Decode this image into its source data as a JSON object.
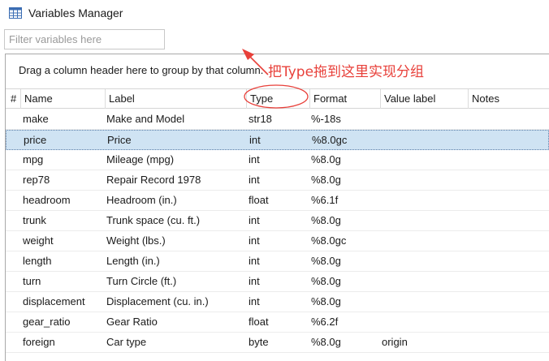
{
  "window": {
    "title": "Variables Manager",
    "icon": "grid-table-icon"
  },
  "filter": {
    "placeholder": "Filter variables here",
    "value": ""
  },
  "group_panel": {
    "hint": "Drag a column header here to group by that column."
  },
  "annotation": {
    "text": "把Type拖到这里实现分组",
    "color": "#e8403a"
  },
  "columns": [
    "#",
    "Name",
    "Label",
    "Type",
    "Format",
    "Value label",
    "Notes"
  ],
  "rows": [
    {
      "name": "make",
      "label": "Make and Model",
      "type": "str18",
      "format": "%-18s",
      "value_label": "",
      "notes": ""
    },
    {
      "name": "price",
      "label": "Price",
      "type": "int",
      "format": "%8.0gc",
      "value_label": "",
      "notes": ""
    },
    {
      "name": "mpg",
      "label": "Mileage (mpg)",
      "type": "int",
      "format": "%8.0g",
      "value_label": "",
      "notes": ""
    },
    {
      "name": "rep78",
      "label": "Repair Record 1978",
      "type": "int",
      "format": "%8.0g",
      "value_label": "",
      "notes": ""
    },
    {
      "name": "headroom",
      "label": "Headroom (in.)",
      "type": "float",
      "format": "%6.1f",
      "value_label": "",
      "notes": ""
    },
    {
      "name": "trunk",
      "label": "Trunk space (cu. ft.)",
      "type": "int",
      "format": "%8.0g",
      "value_label": "",
      "notes": ""
    },
    {
      "name": "weight",
      "label": "Weight (lbs.)",
      "type": "int",
      "format": "%8.0gc",
      "value_label": "",
      "notes": ""
    },
    {
      "name": "length",
      "label": "Length (in.)",
      "type": "int",
      "format": "%8.0g",
      "value_label": "",
      "notes": ""
    },
    {
      "name": "turn",
      "label": "Turn Circle (ft.)",
      "type": "int",
      "format": "%8.0g",
      "value_label": "",
      "notes": ""
    },
    {
      "name": "displacement",
      "label": "Displacement (cu. in.)",
      "type": "int",
      "format": "%8.0g",
      "value_label": "",
      "notes": ""
    },
    {
      "name": "gear_ratio",
      "label": "Gear Ratio",
      "type": "float",
      "format": "%6.2f",
      "value_label": "",
      "notes": ""
    },
    {
      "name": "foreign",
      "label": "Car type",
      "type": "byte",
      "format": "%8.0g",
      "value_label": "origin",
      "notes": ""
    }
  ],
  "selected_row": "price",
  "colors": {
    "selection": "#cfe3f3",
    "annotation": "#e8403a",
    "border": "#a9a9a9"
  }
}
